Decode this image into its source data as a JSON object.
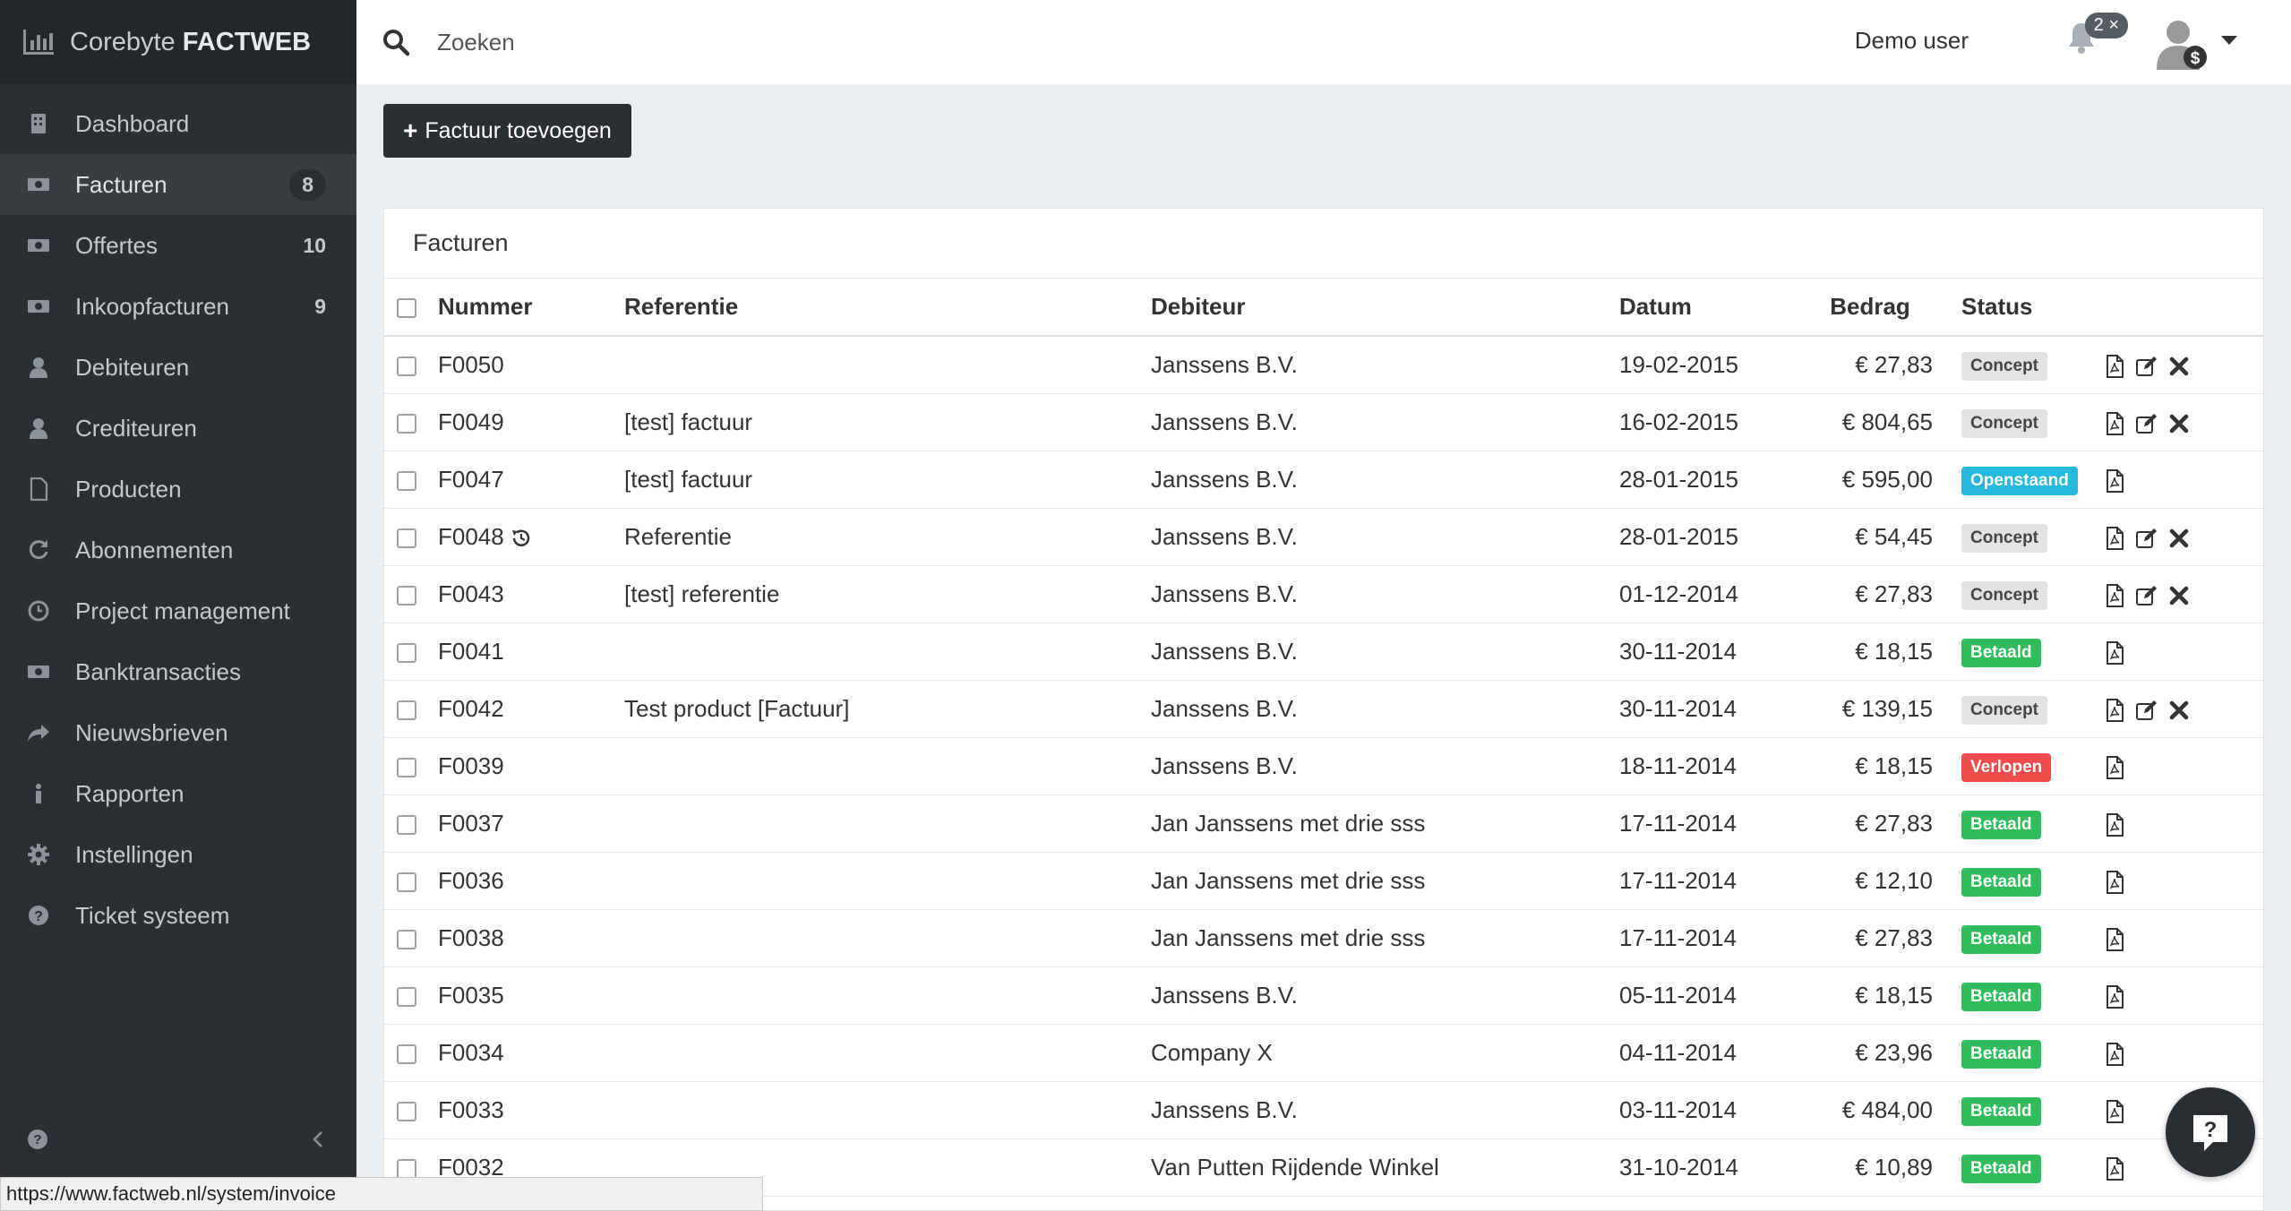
{
  "brand": {
    "prefix": "Corebyte",
    "name": "FACTWEB"
  },
  "sidebar": {
    "items": [
      {
        "label": "Dashboard",
        "icon": "dashboard-icon",
        "count": ""
      },
      {
        "label": "Facturen",
        "icon": "money-icon",
        "count": "8"
      },
      {
        "label": "Offertes",
        "icon": "money-icon",
        "count": "10"
      },
      {
        "label": "Inkoopfacturen",
        "icon": "money-icon",
        "count": "9"
      },
      {
        "label": "Debiteuren",
        "icon": "user-icon",
        "count": ""
      },
      {
        "label": "Crediteuren",
        "icon": "user-icon",
        "count": ""
      },
      {
        "label": "Producten",
        "icon": "file-icon",
        "count": ""
      },
      {
        "label": "Abonnementen",
        "icon": "refresh-icon",
        "count": ""
      },
      {
        "label": "Project management",
        "icon": "clock-icon",
        "count": ""
      },
      {
        "label": "Banktransacties",
        "icon": "money-icon",
        "count": ""
      },
      {
        "label": "Nieuwsbrieven",
        "icon": "share-icon",
        "count": ""
      },
      {
        "label": "Rapporten",
        "icon": "info-icon",
        "count": ""
      },
      {
        "label": "Instellingen",
        "icon": "gear-icon",
        "count": ""
      },
      {
        "label": "Ticket systeem",
        "icon": "question-icon",
        "count": ""
      }
    ]
  },
  "topbar": {
    "search_placeholder": "Zoeken",
    "user_name": "Demo user",
    "notification_badge": "2 ×"
  },
  "toolbar": {
    "add_label": "Factuur toevoegen"
  },
  "panel": {
    "title": "Facturen"
  },
  "table": {
    "headers": {
      "number": "Nummer",
      "reference": "Referentie",
      "debtor": "Debiteur",
      "date": "Datum",
      "amount": "Bedrag",
      "status": "Status"
    },
    "rows": [
      {
        "number": "F0050",
        "reference": "",
        "debtor": "Janssens B.V.",
        "date": "19-02-2015",
        "amount": "€ 27,83",
        "status": "Concept",
        "status_type": "concept",
        "history": false
      },
      {
        "number": "F0049",
        "reference": "[test] factuur",
        "debtor": "Janssens B.V.",
        "date": "16-02-2015",
        "amount": "€ 804,65",
        "status": "Concept",
        "status_type": "concept",
        "history": false
      },
      {
        "number": "F0047",
        "reference": "[test] factuur",
        "debtor": "Janssens B.V.",
        "date": "28-01-2015",
        "amount": "€ 595,00",
        "status": "Openstaand",
        "status_type": "open",
        "history": false
      },
      {
        "number": "F0048",
        "reference": "Referentie",
        "debtor": "Janssens B.V.",
        "date": "28-01-2015",
        "amount": "€ 54,45",
        "status": "Concept",
        "status_type": "concept",
        "history": true
      },
      {
        "number": "F0043",
        "reference": "[test] referentie",
        "debtor": "Janssens B.V.",
        "date": "01-12-2014",
        "amount": "€ 27,83",
        "status": "Concept",
        "status_type": "concept",
        "history": false
      },
      {
        "number": "F0041",
        "reference": "",
        "debtor": "Janssens B.V.",
        "date": "30-11-2014",
        "amount": "€ 18,15",
        "status": "Betaald",
        "status_type": "paid",
        "history": false
      },
      {
        "number": "F0042",
        "reference": "Test product [Factuur]",
        "debtor": "Janssens B.V.",
        "date": "30-11-2014",
        "amount": "€ 139,15",
        "status": "Concept",
        "status_type": "concept",
        "history": false
      },
      {
        "number": "F0039",
        "reference": "",
        "debtor": "Janssens B.V.",
        "date": "18-11-2014",
        "amount": "€ 18,15",
        "status": "Verlopen",
        "status_type": "late",
        "history": false
      },
      {
        "number": "F0037",
        "reference": "",
        "debtor": "Jan Janssens met drie sss",
        "date": "17-11-2014",
        "amount": "€ 27,83",
        "status": "Betaald",
        "status_type": "paid",
        "history": false
      },
      {
        "number": "F0036",
        "reference": "",
        "debtor": "Jan Janssens met drie sss",
        "date": "17-11-2014",
        "amount": "€ 12,10",
        "status": "Betaald",
        "status_type": "paid",
        "history": false
      },
      {
        "number": "F0038",
        "reference": "",
        "debtor": "Jan Janssens met drie sss",
        "date": "17-11-2014",
        "amount": "€ 27,83",
        "status": "Betaald",
        "status_type": "paid",
        "history": false
      },
      {
        "number": "F0035",
        "reference": "",
        "debtor": "Janssens B.V.",
        "date": "05-11-2014",
        "amount": "€ 18,15",
        "status": "Betaald",
        "status_type": "paid",
        "history": false
      },
      {
        "number": "F0034",
        "reference": "",
        "debtor": "Company X",
        "date": "04-11-2014",
        "amount": "€ 23,96",
        "status": "Betaald",
        "status_type": "paid",
        "history": false
      },
      {
        "number": "F0033",
        "reference": "",
        "debtor": "Janssens B.V.",
        "date": "03-11-2014",
        "amount": "€ 484,00",
        "status": "Betaald",
        "status_type": "paid",
        "history": false
      },
      {
        "number": "F0032",
        "reference": "",
        "debtor": "Van Putten Rijdende Winkel",
        "date": "31-10-2014",
        "amount": "€ 10,89",
        "status": "Betaald",
        "status_type": "paid",
        "history": false
      }
    ]
  },
  "status_bar": {
    "url": "https://www.factweb.nl/system/invoice"
  },
  "colors": {
    "sidebar": "#2b2f33",
    "concept": "#e1e3e5",
    "open": "#25b9de",
    "paid": "#2ebd5a",
    "late": "#ef4b4b"
  }
}
